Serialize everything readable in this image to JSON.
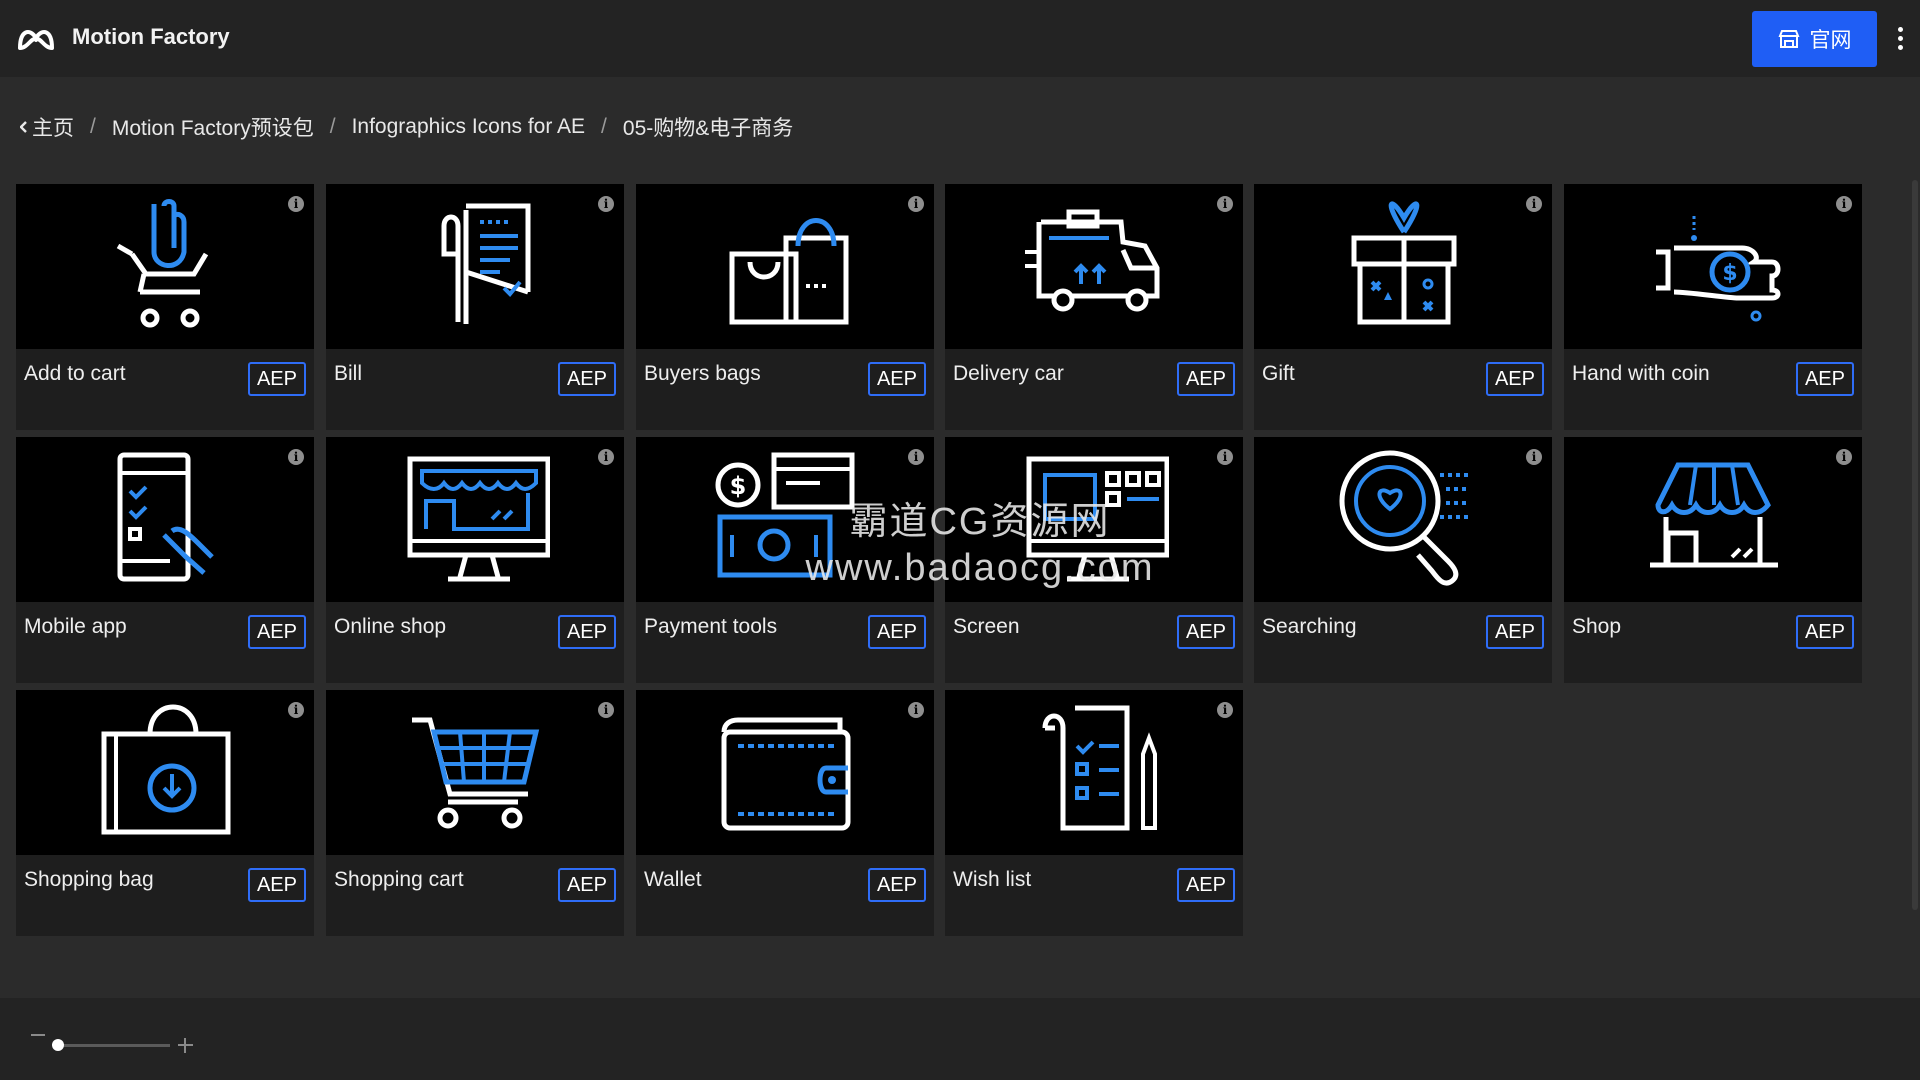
{
  "header": {
    "app_title": "Motion Factory",
    "official_label": "官网",
    "logo_icon": "motion-factory-logo",
    "button_color": "#1f5ef5"
  },
  "breadcrumb": {
    "items": [
      "主页",
      "Motion Factory预设包",
      "Infographics Icons for AE",
      "05-购物&电子商务"
    ],
    "separator": "/"
  },
  "items": [
    {
      "label": "Add to cart",
      "badge": "AEP",
      "icon": "hand-cart-icon"
    },
    {
      "label": "Bill",
      "badge": "AEP",
      "icon": "bill-icon"
    },
    {
      "label": "Buyers bags",
      "badge": "AEP",
      "icon": "bags-icon"
    },
    {
      "label": "Delivery car",
      "badge": "AEP",
      "icon": "truck-icon"
    },
    {
      "label": "Gift",
      "badge": "AEP",
      "icon": "gift-icon"
    },
    {
      "label": "Hand with coin",
      "badge": "AEP",
      "icon": "hand-coin-icon"
    },
    {
      "label": "Mobile app",
      "badge": "AEP",
      "icon": "mobile-icon"
    },
    {
      "label": "Online shop",
      "badge": "AEP",
      "icon": "monitor-shop-icon"
    },
    {
      "label": "Payment tools",
      "badge": "AEP",
      "icon": "payment-icon"
    },
    {
      "label": "Screen",
      "badge": "AEP",
      "icon": "screen-icon"
    },
    {
      "label": "Searching",
      "badge": "AEP",
      "icon": "magnifier-icon"
    },
    {
      "label": "Shop",
      "badge": "AEP",
      "icon": "shop-icon"
    },
    {
      "label": "Shopping bag",
      "badge": "AEP",
      "icon": "shopping-bag-icon"
    },
    {
      "label": "Shopping cart",
      "badge": "AEP",
      "icon": "cart-icon"
    },
    {
      "label": "Wallet",
      "badge": "AEP",
      "icon": "wallet-icon"
    },
    {
      "label": "Wish list",
      "badge": "AEP",
      "icon": "wishlist-icon"
    }
  ],
  "watermark": {
    "line1": "霸道CG资源网",
    "line2": "www.badaocg.com"
  },
  "colors": {
    "accent": "#1f5ef5",
    "icon_white": "#ffffff",
    "icon_blue": "#2e8bf0"
  }
}
